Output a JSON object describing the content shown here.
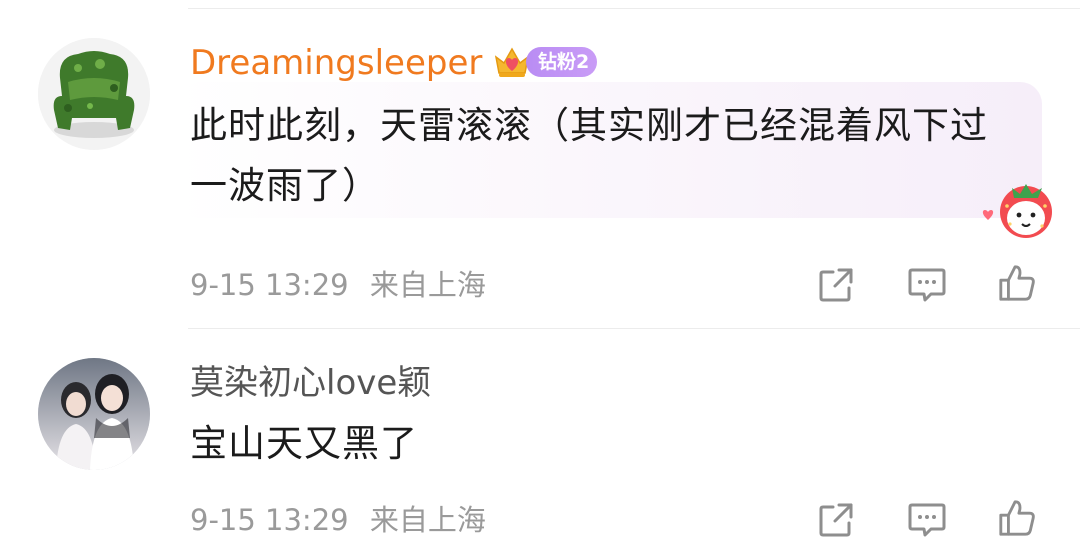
{
  "comments": [
    {
      "username": "Dreamingsleeper",
      "badge_label": "钻粉2",
      "avatar_icon": "grass-armchair-avatar",
      "text_line1": "此时此刻，天雷滚滚（其实刚才已经混着风下过",
      "text_line2": "一波雨了）",
      "sticker_icon": "strawberry-face-sticker",
      "time": "9-15 13:29",
      "location": "来自上海"
    },
    {
      "username": "莫染初心love颖",
      "avatar_icon": "two-girls-avatar",
      "text_line1": "宝山天又黑了",
      "time": "9-15 13:29",
      "location": "来自上海"
    }
  ],
  "actions": {
    "share_icon": "share-icon",
    "reply_icon": "comment-icon",
    "like_icon": "thumbs-up-icon"
  },
  "colors": {
    "username_vip": "#f07a1f",
    "username_normal": "#555555",
    "meta_gray": "#9a9a9a",
    "badge_purple": "#b98cf4"
  }
}
